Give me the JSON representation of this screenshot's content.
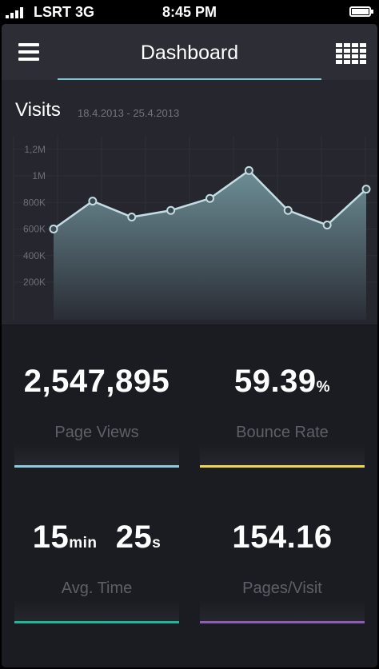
{
  "status_bar": {
    "carrier": "LSRT 3G",
    "time": "8:45 PM"
  },
  "navbar": {
    "title": "Dashboard",
    "menu_icon": "hamburger-menu-icon",
    "grid_icon": "grid-icon"
  },
  "visits": {
    "title": "Visits",
    "date_range": "18.4.2013 - 25.4.2013"
  },
  "chart_data": {
    "type": "area",
    "title": "Visits",
    "ytick_labels": [
      "1,2M",
      "1M",
      "800K",
      "600K",
      "400K",
      "200K"
    ],
    "ytick_values": [
      1200000,
      1000000,
      800000,
      600000,
      400000,
      200000
    ],
    "ylim": [
      0,
      1300000
    ],
    "grid": true,
    "series": [
      {
        "values": [
          600000,
          810000,
          690000,
          740000,
          830000,
          1040000,
          740000,
          630000,
          900000
        ]
      }
    ],
    "colors": {
      "line": "#c3dde3",
      "fill_top": "#6d8e96",
      "fill_bottom": "#2a2d35"
    }
  },
  "stats": {
    "page_views": {
      "value": "2,547,895",
      "label": "Page Views",
      "color": "#8ccbe0"
    },
    "bounce_rate": {
      "value": "59.39",
      "unit": "%",
      "label": "Bounce Rate",
      "color": "#f0d84c"
    },
    "avg_time": {
      "minutes": "15",
      "min_unit": "min",
      "seconds": "25",
      "sec_unit": "s",
      "label": "Avg. Time",
      "color": "#1bb89a"
    },
    "pages_visit": {
      "value": "154.16",
      "label": "Pages/Visit",
      "color": "#8c5cb8"
    }
  }
}
